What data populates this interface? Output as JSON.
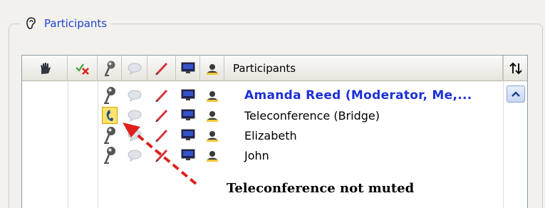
{
  "group": {
    "title": "Participants",
    "icon": "ear-icon"
  },
  "list": {
    "header": {
      "title": "Participants",
      "sort_icon": "sort-arrows-icon",
      "column_icons": [
        "raise-hand-icon",
        "approve-deny-icon",
        "microphone-icon",
        "chat-icon",
        "pen-icon",
        "monitor-icon",
        "webcam-icon"
      ]
    },
    "rows": [
      {
        "name": "Amanda Reed (Moderator, Me,...",
        "moderator": true,
        "audio": "microphone-icon"
      },
      {
        "name": "Teleconference (Bridge)",
        "moderator": false,
        "audio": "phone-icon"
      },
      {
        "name": "Elizabeth",
        "moderator": false,
        "audio": "microphone-icon"
      },
      {
        "name": "John",
        "moderator": false,
        "audio": "microphone-icon"
      }
    ]
  },
  "annotation": {
    "text": "Teleconference not muted",
    "arrow_color": "#e0201b"
  },
  "colors": {
    "moderator_name": "#1c30d6",
    "group_title": "#1f45c8",
    "unmuted_highlight": "#ffe36a"
  }
}
